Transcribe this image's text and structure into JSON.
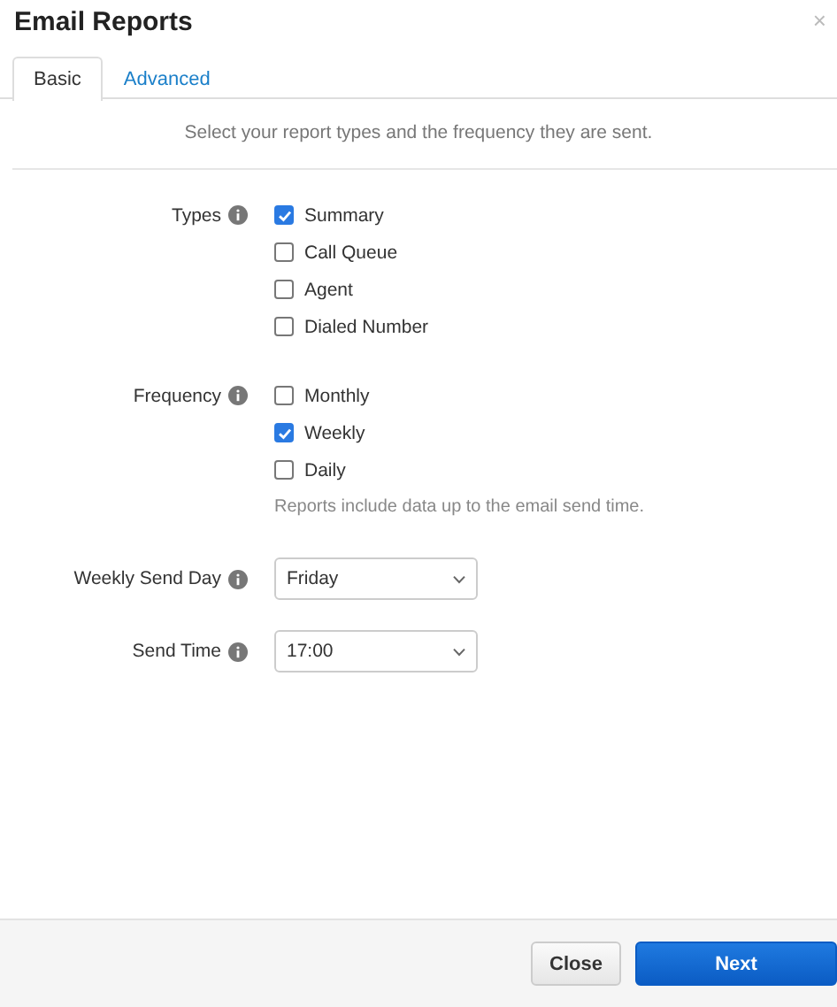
{
  "window": {
    "title": "Email Reports",
    "close": "×"
  },
  "tabs": [
    {
      "label": "Basic",
      "selected": true
    },
    {
      "label": "Advanced",
      "selected": false
    }
  ],
  "intro": "Select your report types and the frequency they are sent.",
  "fields": [
    {
      "kind": "checks",
      "label": "Types",
      "options": [
        {
          "label": "Summary",
          "checked": true
        },
        {
          "label": "Call Queue",
          "checked": false
        },
        {
          "label": "Agent",
          "checked": false
        },
        {
          "label": "Dialed Number",
          "checked": false
        }
      ]
    },
    {
      "kind": "checks",
      "label": "Frequency",
      "options": [
        {
          "label": "Monthly",
          "checked": false
        },
        {
          "label": "Weekly",
          "checked": true
        },
        {
          "label": "Daily",
          "checked": false
        }
      ],
      "hint": "Reports include data up to the email send time."
    },
    {
      "kind": "select",
      "label": "Weekly Send Day",
      "value": "Friday"
    },
    {
      "kind": "select",
      "label": "Send Time",
      "value": "17:00"
    }
  ],
  "buttons": [
    {
      "label": "Close",
      "kind": "secondary"
    },
    {
      "label": "Next",
      "kind": "primary"
    }
  ]
}
